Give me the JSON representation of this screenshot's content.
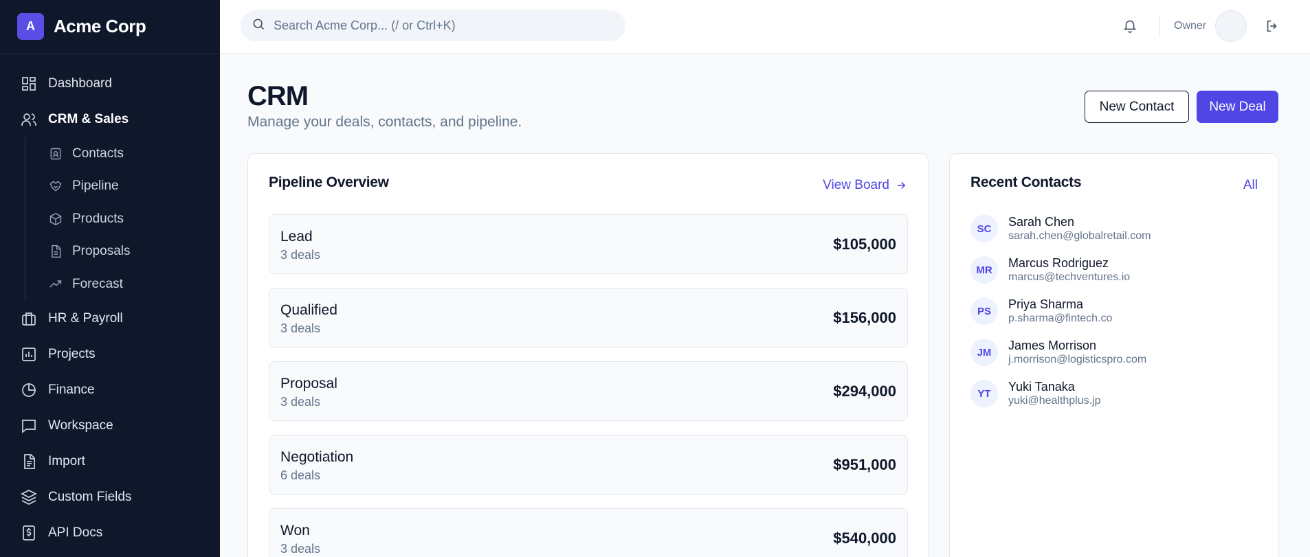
{
  "brand": {
    "logo_letter": "A",
    "name": "Acme Corp"
  },
  "sidebar": {
    "items": [
      {
        "label": "Dashboard",
        "icon": "grid-icon"
      },
      {
        "label": "CRM & Sales",
        "icon": "users-icon",
        "active": true
      },
      {
        "label": "HR & Payroll",
        "icon": "briefcase-icon"
      },
      {
        "label": "Projects",
        "icon": "chart-icon"
      },
      {
        "label": "Finance",
        "icon": "pie-icon"
      },
      {
        "label": "Workspace",
        "icon": "message-icon"
      },
      {
        "label": "Import",
        "icon": "file-icon"
      },
      {
        "label": "Custom Fields",
        "icon": "layers-icon"
      },
      {
        "label": "API Docs",
        "icon": "dollar-file-icon"
      }
    ],
    "subitems": [
      {
        "label": "Contacts",
        "icon": "contact-card-icon"
      },
      {
        "label": "Pipeline",
        "icon": "handshake-icon"
      },
      {
        "label": "Products",
        "icon": "box-icon"
      },
      {
        "label": "Proposals",
        "icon": "document-icon"
      },
      {
        "label": "Forecast",
        "icon": "trending-up-icon"
      }
    ]
  },
  "header": {
    "search_placeholder": "Search Acme Corp... (/ or Ctrl+K)",
    "role": "Owner"
  },
  "page": {
    "title": "CRM",
    "subtitle": "Manage your deals, contacts, and pipeline.",
    "new_contact_label": "New Contact",
    "new_deal_label": "New Deal"
  },
  "pipeline": {
    "title": "Pipeline Overview",
    "link_label": "View Board",
    "stages": [
      {
        "name": "Lead",
        "count": "3 deals",
        "value": "$105,000"
      },
      {
        "name": "Qualified",
        "count": "3 deals",
        "value": "$156,000"
      },
      {
        "name": "Proposal",
        "count": "3 deals",
        "value": "$294,000"
      },
      {
        "name": "Negotiation",
        "count": "6 deals",
        "value": "$951,000"
      },
      {
        "name": "Won",
        "count": "3 deals",
        "value": "$540,000"
      }
    ]
  },
  "contacts": {
    "title": "Recent Contacts",
    "link_label": "All",
    "items": [
      {
        "initials": "SC",
        "name": "Sarah Chen",
        "email": "sarah.chen@globalretail.com"
      },
      {
        "initials": "MR",
        "name": "Marcus Rodriguez",
        "email": "marcus@techventures.io"
      },
      {
        "initials": "PS",
        "name": "Priya Sharma",
        "email": "p.sharma@fintech.co"
      },
      {
        "initials": "JM",
        "name": "James Morrison",
        "email": "j.morrison@logisticspro.com"
      },
      {
        "initials": "YT",
        "name": "Yuki Tanaka",
        "email": "yuki@healthplus.jp"
      }
    ]
  },
  "colors": {
    "accent": "#4f46e5",
    "sidebar_bg": "#0f172a"
  }
}
